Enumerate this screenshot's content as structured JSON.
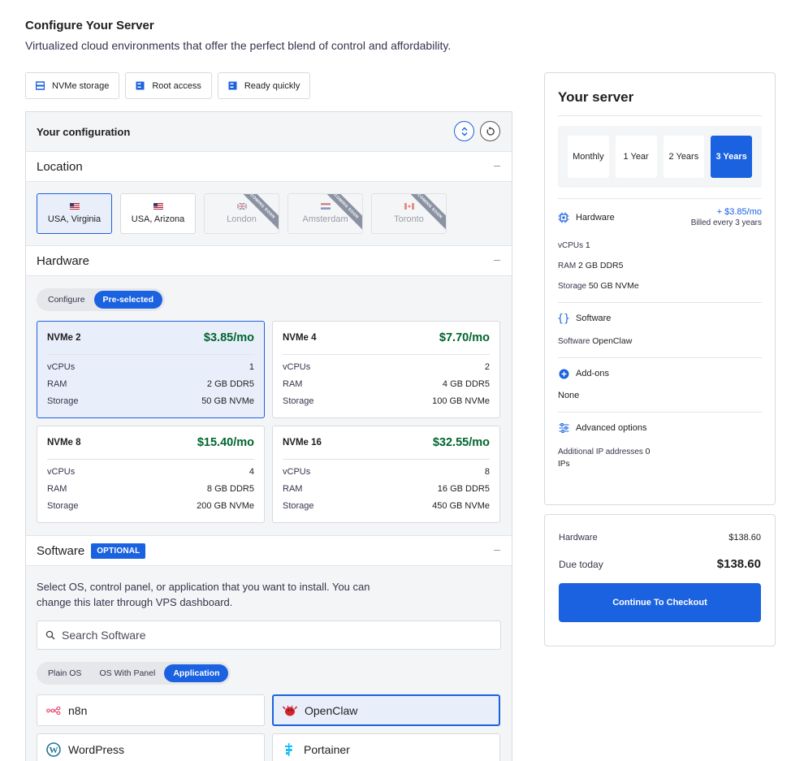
{
  "header": {
    "title": "Configure Your Server",
    "subtitle": "Virtualized cloud environments that offer the perfect blend of control and affordability."
  },
  "features": [
    {
      "label": "NVMe storage",
      "icon": "storage-icon"
    },
    {
      "label": "Root access",
      "icon": "server-icon"
    },
    {
      "label": "Ready quickly",
      "icon": "server-icon"
    }
  ],
  "config": {
    "title": "Your configuration",
    "location": {
      "label": "Location",
      "items": [
        {
          "name": "USA, Virginia",
          "flag": "us-flag",
          "state": "selected"
        },
        {
          "name": "USA, Arizona",
          "flag": "us-flag",
          "state": "available"
        },
        {
          "name": "London",
          "flag": "uk-flag",
          "state": "coming-soon"
        },
        {
          "name": "Amsterdam",
          "flag": "nl-flag",
          "state": "coming-soon"
        },
        {
          "name": "Toronto",
          "flag": "ca-flag",
          "state": "coming-soon"
        }
      ],
      "coming_soon": "COMING SOON"
    },
    "hardware": {
      "label": "Hardware",
      "modes": [
        "Configure",
        "Pre-selected"
      ],
      "selected_mode": "Pre-selected",
      "plans": [
        {
          "name": "NVMe 2",
          "price": "$3.85/mo",
          "vcpus": "1",
          "ram": "2 GB DDR5",
          "storage": "50 GB NVMe"
        },
        {
          "name": "NVMe 4",
          "price": "$7.70/mo",
          "vcpus": "2",
          "ram": "4 GB DDR5",
          "storage": "100 GB NVMe"
        },
        {
          "name": "NVMe 8",
          "price": "$15.40/mo",
          "vcpus": "4",
          "ram": "8 GB DDR5",
          "storage": "200 GB NVMe"
        },
        {
          "name": "NVMe 16",
          "price": "$32.55/mo",
          "vcpus": "8",
          "ram": "16 GB DDR5",
          "storage": "450 GB NVMe"
        }
      ],
      "row_labels": {
        "vcpus": "vCPUs",
        "ram": "RAM",
        "storage": "Storage"
      }
    },
    "software": {
      "label": "Software",
      "badge": "OPTIONAL",
      "description": "Select OS, control panel, or application that you want to install. You can change this later through VPS dashboard.",
      "search_placeholder": "Search Software",
      "tabs": [
        "Plain OS",
        "OS With Panel",
        "Application"
      ],
      "selected_tab": "Application",
      "apps": [
        {
          "name": "n8n",
          "icon": "n8n-icon"
        },
        {
          "name": "OpenClaw",
          "icon": "openclaw-icon"
        },
        {
          "name": "WordPress",
          "icon": "wordpress-icon"
        },
        {
          "name": "Portainer",
          "icon": "portainer-icon"
        }
      ]
    }
  },
  "summary": {
    "title": "Your server",
    "periods": [
      "Monthly",
      "1 Year",
      "2 Years",
      "3 Years"
    ],
    "selected_period": "3 Years",
    "hardware": {
      "label": "Hardware",
      "price": "+ $3.85/mo",
      "billing": "Billed every 3 years",
      "vcpus_label": "vCPUs",
      "vcpus": "1",
      "ram_label": "RAM",
      "ram": "2 GB DDR5",
      "storage_label": "Storage",
      "storage": "50 GB NVMe"
    },
    "software": {
      "label": "Software",
      "key": "Software",
      "value": "OpenClaw"
    },
    "addons": {
      "label": "Add-ons",
      "value": "None"
    },
    "advanced": {
      "label": "Advanced options",
      "key": "Additional IP addresses",
      "value": "0",
      "unit": "IPs"
    }
  },
  "totals": {
    "hardware_label": "Hardware",
    "hardware_value": "$138.60",
    "due_label": "Due today",
    "due_value": "$138.60",
    "checkout": "Continue To Checkout"
  },
  "colors": {
    "accent": "#1a62e0",
    "price_green": "#00652d",
    "panel_bg": "#f4f5f7"
  }
}
